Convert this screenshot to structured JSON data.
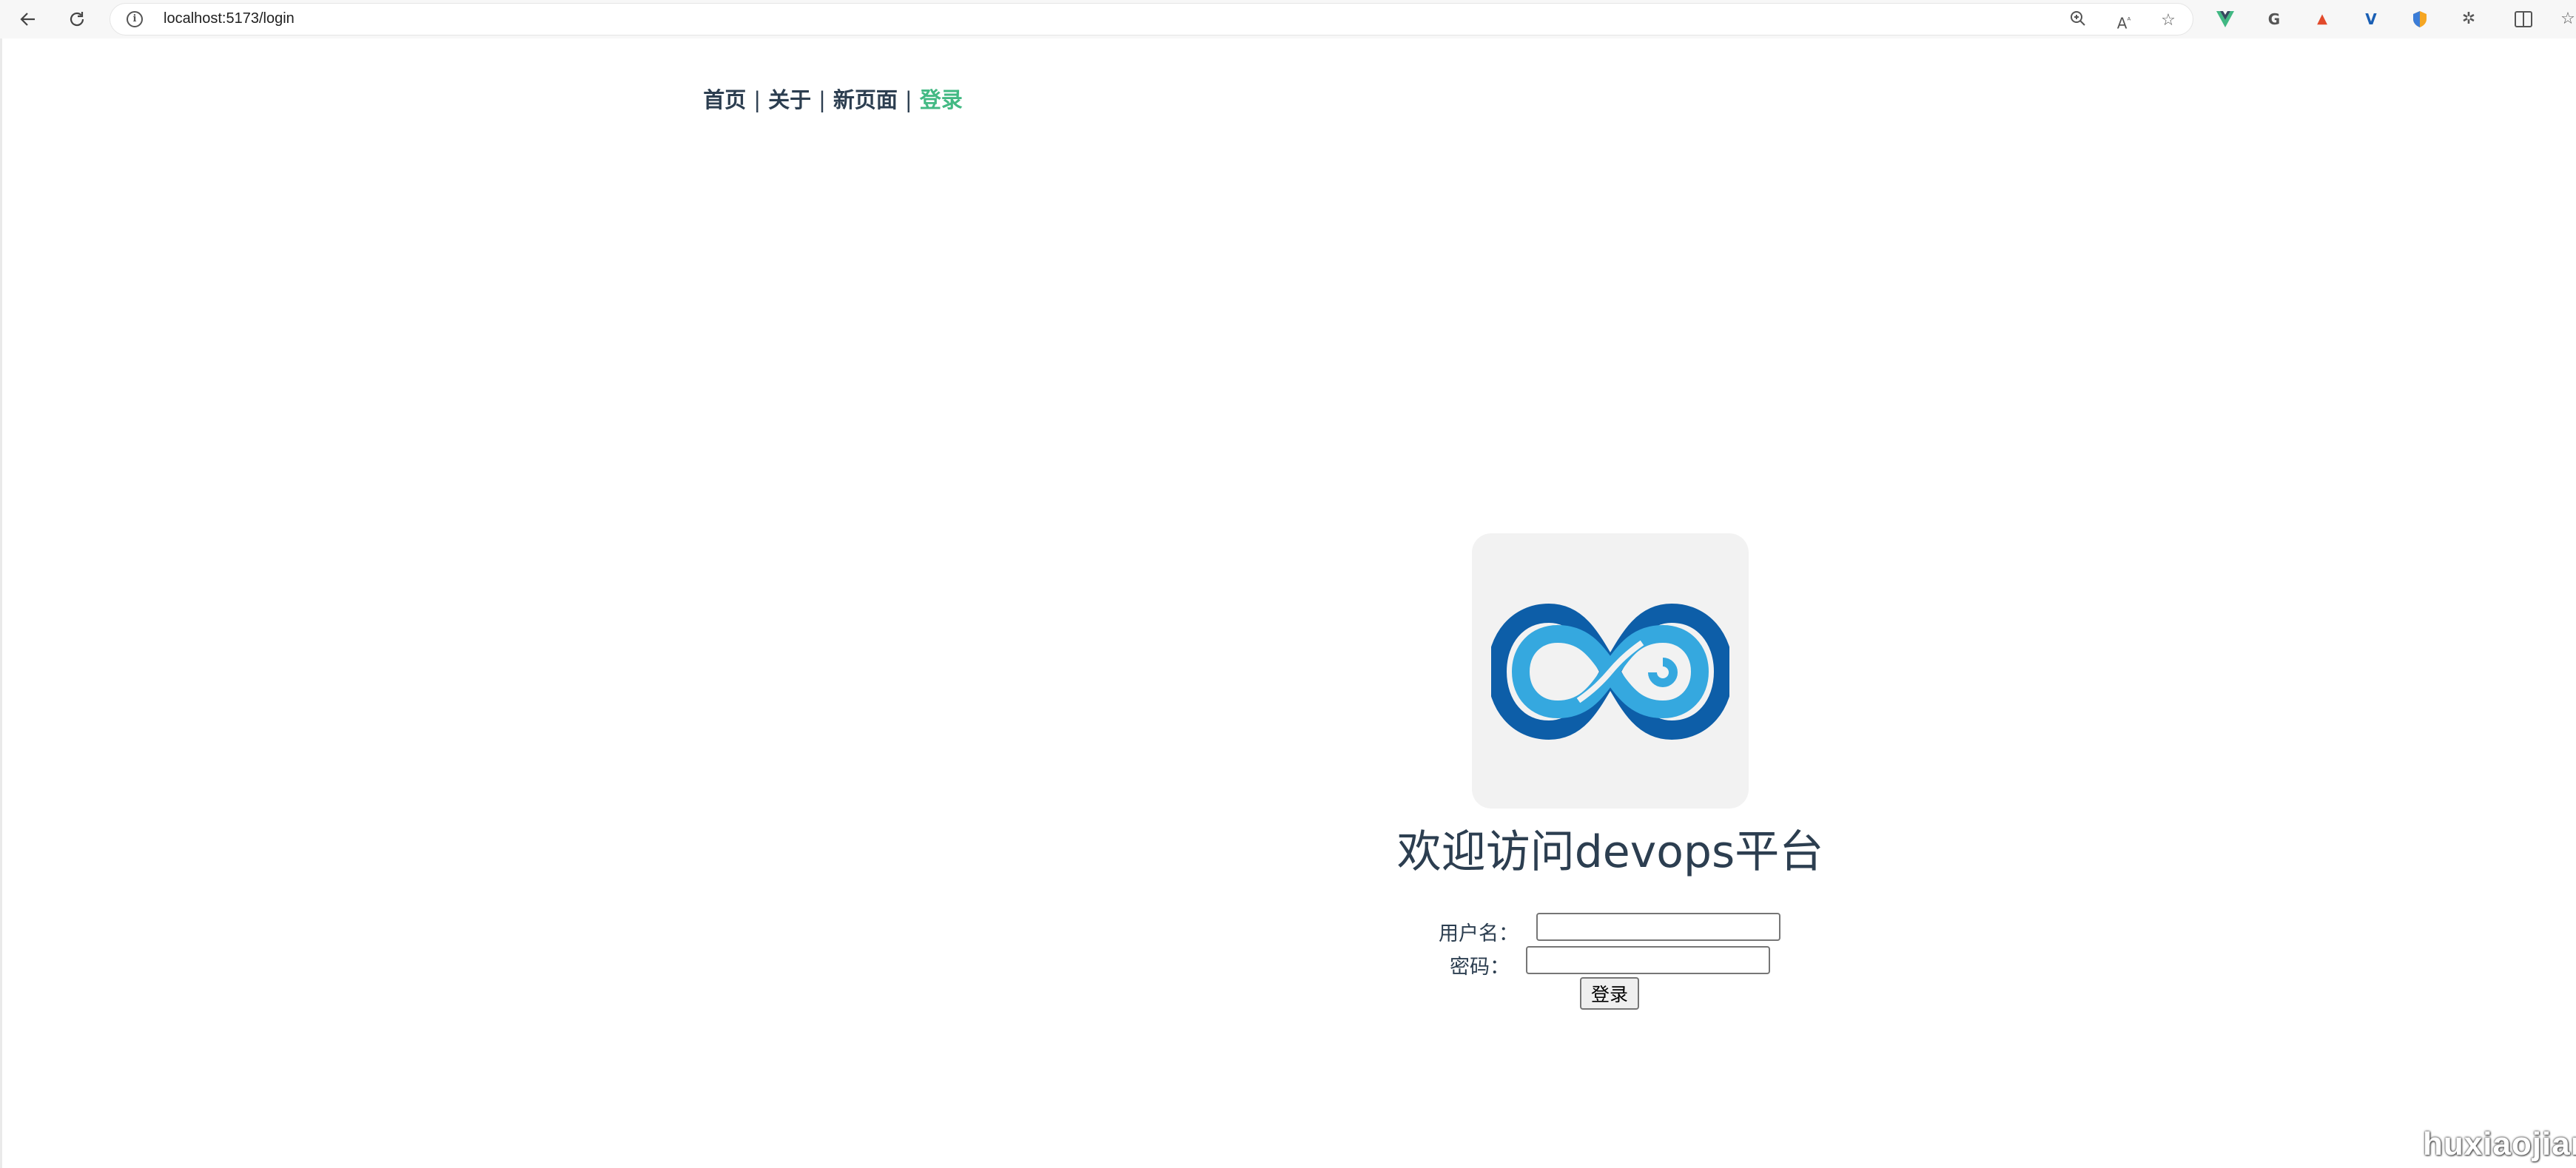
{
  "browser": {
    "url": "localhost:5173/login",
    "icons": {
      "back": "back-arrow-icon",
      "refresh": "refresh-icon",
      "site_info": "info-icon",
      "zoom": "zoom-icon",
      "read_aloud": "read-aloud-icon",
      "favorite": "star-icon",
      "split": "split-screen-icon",
      "favorites": "favorites-icon"
    },
    "extensions": [
      {
        "name": "vue-devtools-extension-icon",
        "color": "#41b883"
      },
      {
        "name": "grammar-extension-icon",
        "color": "#555555"
      },
      {
        "name": "red-extension-icon",
        "color": "#e24a2b"
      },
      {
        "name": "blue-v-extension-icon",
        "color": "#1a5fb4"
      },
      {
        "name": "shield-extension-icon",
        "color": "#f5a623"
      },
      {
        "name": "puzzle-extension-icon",
        "color": "#555555"
      }
    ]
  },
  "nav": {
    "items": [
      {
        "label": "首页",
        "active": false
      },
      {
        "label": "关于",
        "active": false
      },
      {
        "label": "新页面",
        "active": false
      },
      {
        "label": "登录",
        "active": true
      }
    ],
    "separator": "|",
    "active_color": "#42b983",
    "text_color": "#2c3e50"
  },
  "login": {
    "logo": "infinity-devops-logo",
    "welcome": "欢迎访问devops平台",
    "username_label": "用户名：",
    "username_value": "",
    "password_label": "密码：",
    "password_value": "",
    "submit_label": "登录"
  },
  "watermark": "huxiaojian"
}
